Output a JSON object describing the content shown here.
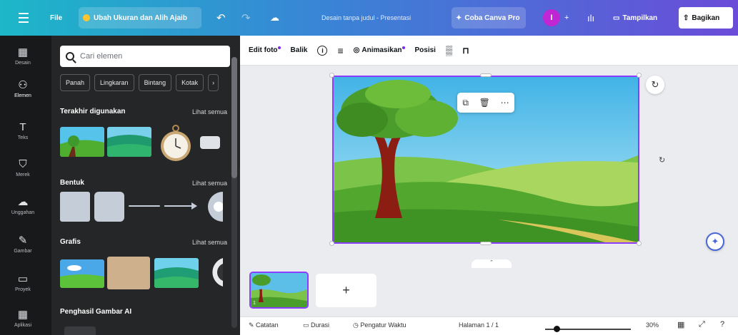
{
  "topbar": {
    "file": "File",
    "resize": "Ubah Ukuran dan Alih Ajaib",
    "doc_title": "Desain tanpa judul - Presentasi",
    "canva_pro": "Coba Canva Pro",
    "avatar_initial": "I",
    "view": "Tampilkan",
    "share": "Bagikan"
  },
  "rail": [
    {
      "label": "Desain",
      "icon": "layout-icon",
      "glyph": "▦"
    },
    {
      "label": "Elemen",
      "icon": "shapes-icon",
      "glyph": "⚇"
    },
    {
      "label": "Teks",
      "icon": "text-icon",
      "glyph": "T"
    },
    {
      "label": "Merek",
      "icon": "brand-icon",
      "glyph": "⛉"
    },
    {
      "label": "Unggahan",
      "icon": "cloud-upload-icon",
      "glyph": "☁"
    },
    {
      "label": "Gambar",
      "icon": "draw-icon",
      "glyph": "✎"
    },
    {
      "label": "Proyek",
      "icon": "folder-icon",
      "glyph": "▭"
    },
    {
      "label": "Aplikasi",
      "icon": "apps-icon",
      "glyph": "▦"
    }
  ],
  "panel": {
    "search_placeholder": "Cari elemen",
    "chips": [
      "Panah",
      "Lingkaran",
      "Bintang",
      "Kotak"
    ],
    "recent_title": "Terakhir digunakan",
    "see_all": "Lihat semua",
    "shapes_title": "Bentuk",
    "graphics_title": "Grafis",
    "ai_title": "Penghasil Gambar AI"
  },
  "ctx": {
    "edit_photo": "Edit foto",
    "flip": "Balik",
    "animate": "Animasikan",
    "position": "Posisi"
  },
  "bottom": {
    "notes": "Catatan",
    "duration": "Durasi",
    "timer": "Pengatur Waktu",
    "page": "Halaman 1 / 1",
    "zoom": "30%",
    "zoom_level": 0.3
  },
  "page_thumb_number": "1",
  "colors": {
    "accent": "#8b3dff",
    "topbar_start": "#1cb7c8",
    "topbar_end": "#6a4cd8",
    "panel_bg": "#252627",
    "rail_bg": "#18191b"
  }
}
